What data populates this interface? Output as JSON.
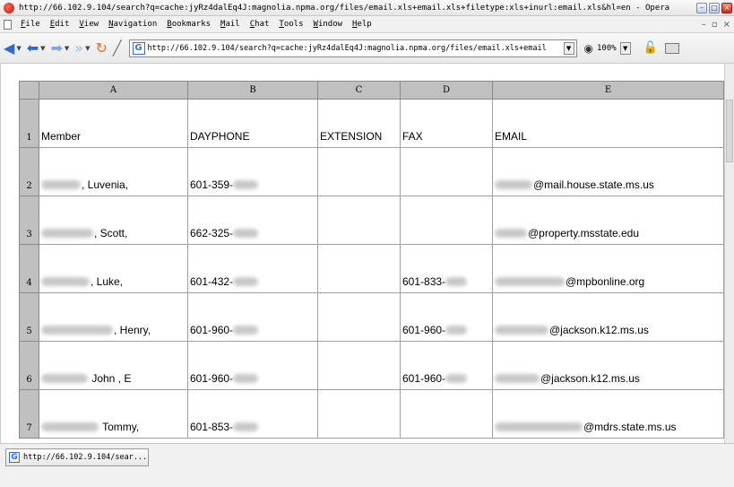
{
  "window": {
    "title": "http://66.102.9.104/search?q=cache:jyRz4dalEq4J:magnolia.npma.org/files/email.xls+email.xls+filetype:xls+inurl:email.xls&hl=en - Opera"
  },
  "menu": {
    "items": [
      "File",
      "Edit",
      "View",
      "Navigation",
      "Bookmarks",
      "Mail",
      "Chat",
      "Tools",
      "Window",
      "Help"
    ]
  },
  "toolbar": {
    "address_value": "http://66.102.9.104/search?q=cache:jyRz4dalEq4J:magnolia.npma.org/files/email.xls+email",
    "zoom": "100%"
  },
  "sheet": {
    "columns": [
      "A",
      "B",
      "C",
      "D",
      "E"
    ],
    "rows": [
      {
        "num": "1",
        "cells": [
          "Member",
          "DAYPHONE",
          "EXTENSION",
          "FAX",
          "EMAIL"
        ]
      },
      {
        "num": "2",
        "cells": [
          ", Luvenia,",
          "601-359-",
          "",
          "",
          "@mail.house.state.ms.us"
        ]
      },
      {
        "num": "3",
        "cells": [
          ", Scott,",
          "662-325-",
          "",
          "",
          "@property.msstate.edu"
        ]
      },
      {
        "num": "4",
        "cells": [
          ", Luke,",
          "601-432-",
          "",
          "601-833-",
          "@mpbonline.org"
        ]
      },
      {
        "num": "5",
        "cells": [
          ", Henry,",
          "601-960-",
          "",
          "601-960-",
          "@jackson.k12.ms.us"
        ]
      },
      {
        "num": "6",
        "cells": [
          " John  , E",
          "601-960-",
          "",
          "601-960-",
          "@jackson.k12.ms.us"
        ]
      },
      {
        "num": "7",
        "cells": [
          " Tommy,",
          "601-853-",
          "",
          "",
          "@mdrs.state.ms.us"
        ]
      }
    ]
  },
  "statusbar": {
    "tab_label": "http://66.102.9.104/sear..."
  }
}
